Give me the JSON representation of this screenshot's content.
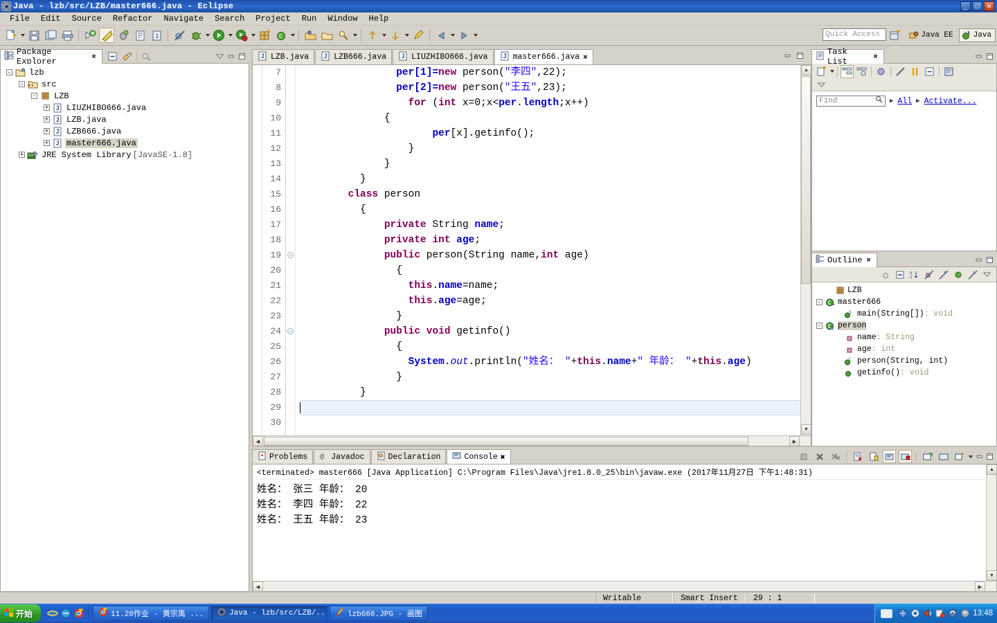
{
  "window": {
    "title": "Java - lzb/src/LZB/master666.java - Eclipse",
    "minimize": "_",
    "maximize": "□",
    "close": "✕"
  },
  "menu": {
    "items": [
      "File",
      "Edit",
      "Source",
      "Refactor",
      "Navigate",
      "Search",
      "Project",
      "Run",
      "Window",
      "Help"
    ]
  },
  "toolbar": {
    "quick_access_placeholder": "Quick Access",
    "perspectives": [
      {
        "label": "Java EE",
        "active": false
      },
      {
        "label": "Java",
        "active": true
      }
    ]
  },
  "package_explorer": {
    "tab_label": "Package Explorer",
    "tree": [
      {
        "label": "lzb",
        "depth": 0,
        "expander": "-",
        "icon": "project-icon"
      },
      {
        "label": "src",
        "depth": 1,
        "expander": "-",
        "icon": "source-folder-icon"
      },
      {
        "label": "LZB",
        "depth": 2,
        "expander": "-",
        "icon": "package-icon"
      },
      {
        "label": "LIUZHIBO666.java",
        "depth": 3,
        "expander": "+",
        "icon": "java-file-icon"
      },
      {
        "label": "LZB.java",
        "depth": 3,
        "expander": "+",
        "icon": "java-file-icon"
      },
      {
        "label": "LZB666.java",
        "depth": 3,
        "expander": "+",
        "icon": "java-file-icon"
      },
      {
        "label": "master666.java",
        "depth": 3,
        "expander": "+",
        "icon": "java-file-icon",
        "selected": true
      },
      {
        "label": "JRE System Library",
        "depth": 1,
        "expander": "+",
        "icon": "library-icon",
        "suffix": "[JavaSE-1.8]"
      }
    ]
  },
  "editor": {
    "tabs": [
      {
        "label": "LZB.java",
        "active": false
      },
      {
        "label": "LZB666.java",
        "active": false
      },
      {
        "label": "LIUZHIBO666.java",
        "active": false
      },
      {
        "label": "master666.java",
        "active": true
      }
    ],
    "first_line": 7,
    "cursor_line": 29,
    "lines": [
      {
        "n": 7,
        "indent": 8,
        "tokens": [
          {
            "t": "per[1]=",
            "c": "f"
          },
          {
            "t": "new",
            "c": "k"
          },
          {
            "t": " person(",
            "c": "tx"
          },
          {
            "t": "\"李四\"",
            "c": "s"
          },
          {
            "t": ",22);",
            "c": "tx"
          }
        ]
      },
      {
        "n": 8,
        "indent": 8,
        "tokens": [
          {
            "t": "per[2]=",
            "c": "f"
          },
          {
            "t": "new",
            "c": "k"
          },
          {
            "t": " person(",
            "c": "tx"
          },
          {
            "t": "\"王五\"",
            "c": "s"
          },
          {
            "t": ",23);",
            "c": "tx"
          }
        ]
      },
      {
        "n": 9,
        "indent": 9,
        "tokens": [
          {
            "t": "for",
            "c": "k"
          },
          {
            "t": " (",
            "c": "tx"
          },
          {
            "t": "int",
            "c": "k"
          },
          {
            "t": " x=0;x<",
            "c": "tx"
          },
          {
            "t": "per",
            "c": "f"
          },
          {
            "t": ".",
            "c": "tx"
          },
          {
            "t": "length",
            "c": "f"
          },
          {
            "t": ";x++)",
            "c": "tx"
          }
        ]
      },
      {
        "n": 10,
        "indent": 7,
        "tokens": [
          {
            "t": "{",
            "c": "tx"
          }
        ]
      },
      {
        "n": 11,
        "indent": 11,
        "tokens": [
          {
            "t": "per",
            "c": "f"
          },
          {
            "t": "[x].getinfo();",
            "c": "tx"
          }
        ]
      },
      {
        "n": 12,
        "indent": 9,
        "tokens": [
          {
            "t": "}",
            "c": "tx"
          }
        ]
      },
      {
        "n": 13,
        "indent": 7,
        "tokens": [
          {
            "t": "}",
            "c": "tx"
          }
        ]
      },
      {
        "n": 14,
        "indent": 5,
        "tokens": [
          {
            "t": "}",
            "c": "tx"
          }
        ]
      },
      {
        "n": 15,
        "indent": 4,
        "tokens": [
          {
            "t": "class",
            "c": "k"
          },
          {
            "t": " person",
            "c": "tx"
          }
        ]
      },
      {
        "n": 16,
        "indent": 5,
        "tokens": [
          {
            "t": "{",
            "c": "tx"
          }
        ]
      },
      {
        "n": 17,
        "indent": 7,
        "tokens": [
          {
            "t": "private",
            "c": "k"
          },
          {
            "t": " String ",
            "c": "tx"
          },
          {
            "t": "name",
            "c": "f"
          },
          {
            "t": ";",
            "c": "tx"
          }
        ]
      },
      {
        "n": 18,
        "indent": 7,
        "tokens": [
          {
            "t": "private",
            "c": "k"
          },
          {
            "t": " ",
            "c": "tx"
          },
          {
            "t": "int",
            "c": "k"
          },
          {
            "t": " ",
            "c": "tx"
          },
          {
            "t": "age",
            "c": "f"
          },
          {
            "t": ";",
            "c": "tx"
          }
        ]
      },
      {
        "n": 19,
        "indent": 7,
        "fold": true,
        "tokens": [
          {
            "t": "public",
            "c": "k"
          },
          {
            "t": " person(String name,",
            "c": "tx"
          },
          {
            "t": "int",
            "c": "k"
          },
          {
            "t": " age)",
            "c": "tx"
          }
        ]
      },
      {
        "n": 20,
        "indent": 8,
        "tokens": [
          {
            "t": "{",
            "c": "tx"
          }
        ]
      },
      {
        "n": 21,
        "indent": 9,
        "tokens": [
          {
            "t": "this",
            "c": "k"
          },
          {
            "t": ".",
            "c": "tx"
          },
          {
            "t": "name",
            "c": "f"
          },
          {
            "t": "=name;",
            "c": "tx"
          }
        ]
      },
      {
        "n": 22,
        "indent": 9,
        "tokens": [
          {
            "t": "this",
            "c": "k"
          },
          {
            "t": ".",
            "c": "tx"
          },
          {
            "t": "age",
            "c": "f"
          },
          {
            "t": "=age;",
            "c": "tx"
          }
        ]
      },
      {
        "n": 23,
        "indent": 8,
        "tokens": [
          {
            "t": "}",
            "c": "tx"
          }
        ]
      },
      {
        "n": 24,
        "indent": 7,
        "fold": true,
        "tokens": [
          {
            "t": "public",
            "c": "k"
          },
          {
            "t": " ",
            "c": "tx"
          },
          {
            "t": "void",
            "c": "k"
          },
          {
            "t": " getinfo()",
            "c": "tx"
          }
        ]
      },
      {
        "n": 25,
        "indent": 8,
        "tokens": [
          {
            "t": "{",
            "c": "tx"
          }
        ]
      },
      {
        "n": 26,
        "indent": 9,
        "tokens": [
          {
            "t": "System",
            "c": "f"
          },
          {
            "t": ".",
            "c": "tx"
          },
          {
            "t": "out",
            "c": "st"
          },
          {
            "t": ".println(",
            "c": "tx"
          },
          {
            "t": "\"姓名： \"",
            "c": "s"
          },
          {
            "t": "+",
            "c": "tx"
          },
          {
            "t": "this",
            "c": "k"
          },
          {
            "t": ".",
            "c": "tx"
          },
          {
            "t": "name",
            "c": "f"
          },
          {
            "t": "+",
            "c": "tx"
          },
          {
            "t": "\" 年龄： \"",
            "c": "s"
          },
          {
            "t": "+",
            "c": "tx"
          },
          {
            "t": "this",
            "c": "k"
          },
          {
            "t": ".",
            "c": "tx"
          },
          {
            "t": "age",
            "c": "f"
          },
          {
            "t": ")",
            "c": "tx"
          }
        ]
      },
      {
        "n": 27,
        "indent": 8,
        "tokens": [
          {
            "t": "}",
            "c": "tx"
          }
        ]
      },
      {
        "n": 28,
        "indent": 5,
        "tokens": [
          {
            "t": "}",
            "c": "tx"
          }
        ]
      },
      {
        "n": 29,
        "indent": 0,
        "tokens": [],
        "cursor": true
      },
      {
        "n": 30,
        "indent": 0,
        "tokens": []
      }
    ]
  },
  "console": {
    "tabs": [
      {
        "label": "Problems",
        "icon": "problems-icon",
        "active": false
      },
      {
        "label": "Javadoc",
        "icon": "javadoc-icon",
        "active": false
      },
      {
        "label": "Declaration",
        "icon": "declaration-icon",
        "active": false
      },
      {
        "label": "Console",
        "icon": "console-icon",
        "active": true
      }
    ],
    "header": "<terminated> master666 [Java Application] C:\\Program Files\\Java\\jre1.8.0_25\\bin\\javaw.exe (2017年11月27日 下午1:48:31)",
    "output": [
      "姓名： 张三 年龄： 20",
      "姓名： 李四 年龄： 22",
      "姓名： 王五 年龄： 23"
    ]
  },
  "task_list": {
    "tab_label": "Task List",
    "find_placeholder": "Find",
    "link_all": "All",
    "link_activate": "Activate..."
  },
  "outline": {
    "tab_label": "Outline",
    "tree": [
      {
        "label": "LZB",
        "depth": 1,
        "expander": "",
        "icon": "package-icon"
      },
      {
        "label": "master666",
        "depth": 0,
        "expander": "-",
        "icon": "class-icon"
      },
      {
        "label": "main(String[])",
        "depth": 2,
        "expander": "",
        "icon": "method-public-static-icon",
        "ret": " : void"
      },
      {
        "label": "person",
        "depth": 0,
        "expander": "-",
        "icon": "class-default-icon",
        "selected": true
      },
      {
        "label": "name",
        "depth": 2,
        "expander": "",
        "icon": "field-private-icon",
        "ret": " : String"
      },
      {
        "label": "age",
        "depth": 2,
        "expander": "",
        "icon": "field-private-icon",
        "ret": " : int"
      },
      {
        "label": "person(String, int)",
        "depth": 2,
        "expander": "",
        "icon": "constructor-icon",
        "ret": ""
      },
      {
        "label": "getinfo()",
        "depth": 2,
        "expander": "",
        "icon": "method-public-icon",
        "ret": " : void"
      }
    ]
  },
  "status_bar": {
    "writable": "Writable",
    "insert_mode": "Smart Insert",
    "position": "29 : 1"
  },
  "taskbar": {
    "start_label": "开始",
    "buttons": [
      {
        "label": "11.20作业 - 黄宗禹 ...",
        "icon": "chrome-icon",
        "active": false
      },
      {
        "label": "Java - lzb/src/LZB/...",
        "icon": "eclipse-icon",
        "active": true
      },
      {
        "label": "lzb666.JPG - 画图",
        "icon": "paint-icon",
        "active": false
      }
    ],
    "clock": "13:48"
  },
  "colors": {
    "keyword": "#7f0055",
    "string": "#2a00ff",
    "field": "#0000c0",
    "accent": "#1f5bc4",
    "cursor_line": "#eaf2fb"
  }
}
